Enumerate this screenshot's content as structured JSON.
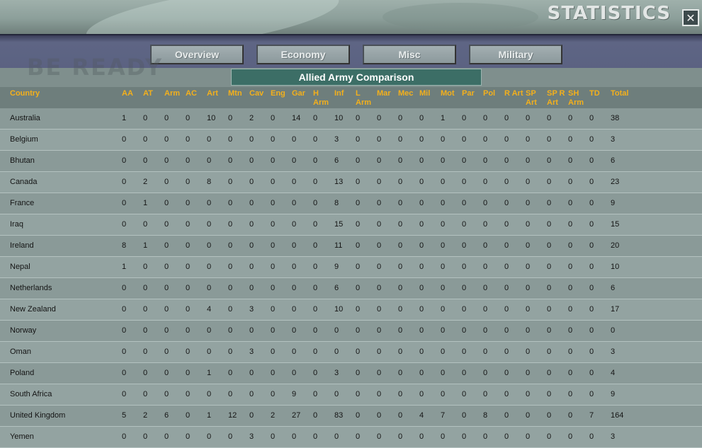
{
  "window": {
    "title": "STATISTICS",
    "close_glyph": "✕",
    "watermark": "BE READY"
  },
  "nav": {
    "tabs": [
      {
        "label": "Overview"
      },
      {
        "label": "Economy"
      },
      {
        "label": "Misc"
      },
      {
        "label": "Military"
      }
    ]
  },
  "table": {
    "title": "Allied Army Comparison",
    "columns": [
      "Country",
      "AA",
      "AT",
      "Arm",
      "AC",
      "Art",
      "Mtn",
      "Cav",
      "Eng",
      "Gar",
      "H\nArm",
      "Inf",
      "L\nArm",
      "Mar",
      "Mec",
      "Mil",
      "Mot",
      "Par",
      "Pol",
      "R Art",
      "SP\nArt",
      "SP R\nArt",
      "SH\nArm",
      "TD",
      "Total"
    ],
    "rows": [
      [
        "Australia",
        "1",
        "0",
        "0",
        "0",
        "10",
        "0",
        "2",
        "0",
        "14",
        "0",
        "10",
        "0",
        "0",
        "0",
        "0",
        "1",
        "0",
        "0",
        "0",
        "0",
        "0",
        "0",
        "0",
        "38"
      ],
      [
        "Belgium",
        "0",
        "0",
        "0",
        "0",
        "0",
        "0",
        "0",
        "0",
        "0",
        "0",
        "3",
        "0",
        "0",
        "0",
        "0",
        "0",
        "0",
        "0",
        "0",
        "0",
        "0",
        "0",
        "0",
        "3"
      ],
      [
        "Bhutan",
        "0",
        "0",
        "0",
        "0",
        "0",
        "0",
        "0",
        "0",
        "0",
        "0",
        "6",
        "0",
        "0",
        "0",
        "0",
        "0",
        "0",
        "0",
        "0",
        "0",
        "0",
        "0",
        "0",
        "6"
      ],
      [
        "Canada",
        "0",
        "2",
        "0",
        "0",
        "8",
        "0",
        "0",
        "0",
        "0",
        "0",
        "13",
        "0",
        "0",
        "0",
        "0",
        "0",
        "0",
        "0",
        "0",
        "0",
        "0",
        "0",
        "0",
        "23"
      ],
      [
        "France",
        "0",
        "1",
        "0",
        "0",
        "0",
        "0",
        "0",
        "0",
        "0",
        "0",
        "8",
        "0",
        "0",
        "0",
        "0",
        "0",
        "0",
        "0",
        "0",
        "0",
        "0",
        "0",
        "0",
        "9"
      ],
      [
        "Iraq",
        "0",
        "0",
        "0",
        "0",
        "0",
        "0",
        "0",
        "0",
        "0",
        "0",
        "15",
        "0",
        "0",
        "0",
        "0",
        "0",
        "0",
        "0",
        "0",
        "0",
        "0",
        "0",
        "0",
        "15"
      ],
      [
        "Ireland",
        "8",
        "1",
        "0",
        "0",
        "0",
        "0",
        "0",
        "0",
        "0",
        "0",
        "11",
        "0",
        "0",
        "0",
        "0",
        "0",
        "0",
        "0",
        "0",
        "0",
        "0",
        "0",
        "0",
        "20"
      ],
      [
        "Nepal",
        "1",
        "0",
        "0",
        "0",
        "0",
        "0",
        "0",
        "0",
        "0",
        "0",
        "9",
        "0",
        "0",
        "0",
        "0",
        "0",
        "0",
        "0",
        "0",
        "0",
        "0",
        "0",
        "0",
        "10"
      ],
      [
        "Netherlands",
        "0",
        "0",
        "0",
        "0",
        "0",
        "0",
        "0",
        "0",
        "0",
        "0",
        "6",
        "0",
        "0",
        "0",
        "0",
        "0",
        "0",
        "0",
        "0",
        "0",
        "0",
        "0",
        "0",
        "6"
      ],
      [
        "New Zealand",
        "0",
        "0",
        "0",
        "0",
        "4",
        "0",
        "3",
        "0",
        "0",
        "0",
        "10",
        "0",
        "0",
        "0",
        "0",
        "0",
        "0",
        "0",
        "0",
        "0",
        "0",
        "0",
        "0",
        "17"
      ],
      [
        "Norway",
        "0",
        "0",
        "0",
        "0",
        "0",
        "0",
        "0",
        "0",
        "0",
        "0",
        "0",
        "0",
        "0",
        "0",
        "0",
        "0",
        "0",
        "0",
        "0",
        "0",
        "0",
        "0",
        "0",
        "0"
      ],
      [
        "Oman",
        "0",
        "0",
        "0",
        "0",
        "0",
        "0",
        "3",
        "0",
        "0",
        "0",
        "0",
        "0",
        "0",
        "0",
        "0",
        "0",
        "0",
        "0",
        "0",
        "0",
        "0",
        "0",
        "0",
        "3"
      ],
      [
        "Poland",
        "0",
        "0",
        "0",
        "0",
        "1",
        "0",
        "0",
        "0",
        "0",
        "0",
        "3",
        "0",
        "0",
        "0",
        "0",
        "0",
        "0",
        "0",
        "0",
        "0",
        "0",
        "0",
        "0",
        "4"
      ],
      [
        "South Africa",
        "0",
        "0",
        "0",
        "0",
        "0",
        "0",
        "0",
        "0",
        "9",
        "0",
        "0",
        "0",
        "0",
        "0",
        "0",
        "0",
        "0",
        "0",
        "0",
        "0",
        "0",
        "0",
        "0",
        "9"
      ],
      [
        "United Kingdom",
        "5",
        "2",
        "6",
        "0",
        "1",
        "12",
        "0",
        "2",
        "27",
        "0",
        "83",
        "0",
        "0",
        "0",
        "4",
        "7",
        "0",
        "8",
        "0",
        "0",
        "0",
        "0",
        "7",
        "164"
      ],
      [
        "Yemen",
        "0",
        "0",
        "0",
        "0",
        "0",
        "0",
        "3",
        "0",
        "0",
        "0",
        "0",
        "0",
        "0",
        "0",
        "0",
        "0",
        "0",
        "0",
        "0",
        "0",
        "0",
        "0",
        "0",
        "3"
      ]
    ]
  },
  "colors": {
    "header_text": "#f3b01c",
    "subtitle_bg": "#3c6e66",
    "nav_band": "#5b6282"
  }
}
